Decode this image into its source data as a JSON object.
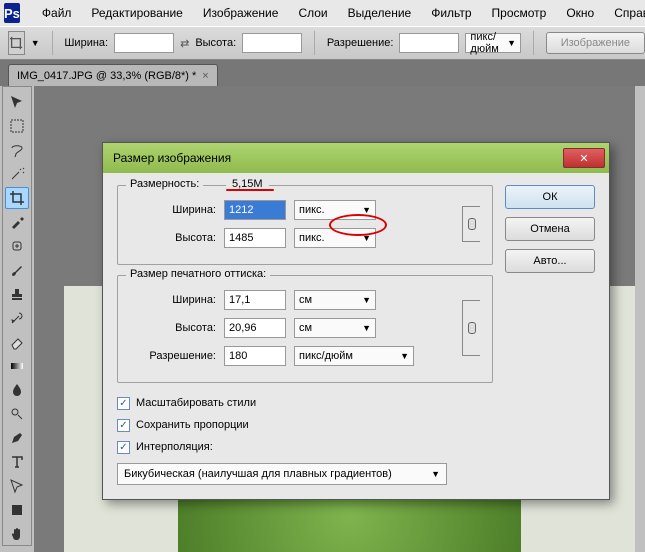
{
  "app": {
    "logo": "Ps"
  },
  "menu": {
    "file": "Файл",
    "edit": "Редактирование",
    "image": "Изображение",
    "layer": "Слои",
    "select": "Выделение",
    "filter": "Фильтр",
    "view": "Просмотр",
    "window": "Окно",
    "help": "Справка"
  },
  "options": {
    "width_label": "Ширина:",
    "height_label": "Высота:",
    "resolution_label": "Разрешение:",
    "unit": "пикс/дюйм",
    "btn_image": "Изображение"
  },
  "tab": {
    "title": "IMG_0417.JPG @ 33,3% (RGB/8*) *"
  },
  "dialog": {
    "title": "Размер изображения",
    "dimensions_legend": "Размерность:",
    "dimensions_size": "5,15M",
    "px_width_label": "Ширина:",
    "px_width_value": "1212",
    "px_height_label": "Высота:",
    "px_height_value": "1485",
    "px_unit": "пикс.",
    "print_legend": "Размер печатного оттиска:",
    "doc_width_label": "Ширина:",
    "doc_width_value": "17,1",
    "doc_height_label": "Высота:",
    "doc_height_value": "20,96",
    "doc_unit": "см",
    "res_label": "Разрешение:",
    "res_value": "180",
    "res_unit": "пикс/дюйм",
    "chk_scale": "Масштабировать стили",
    "chk_constrain": "Сохранить пропорции",
    "chk_resample": "Интерполяция:",
    "interp_value": "Бикубическая (наилучшая для плавных градиентов)",
    "btn_ok": "ОК",
    "btn_cancel": "Отмена",
    "btn_auto": "Авто..."
  }
}
